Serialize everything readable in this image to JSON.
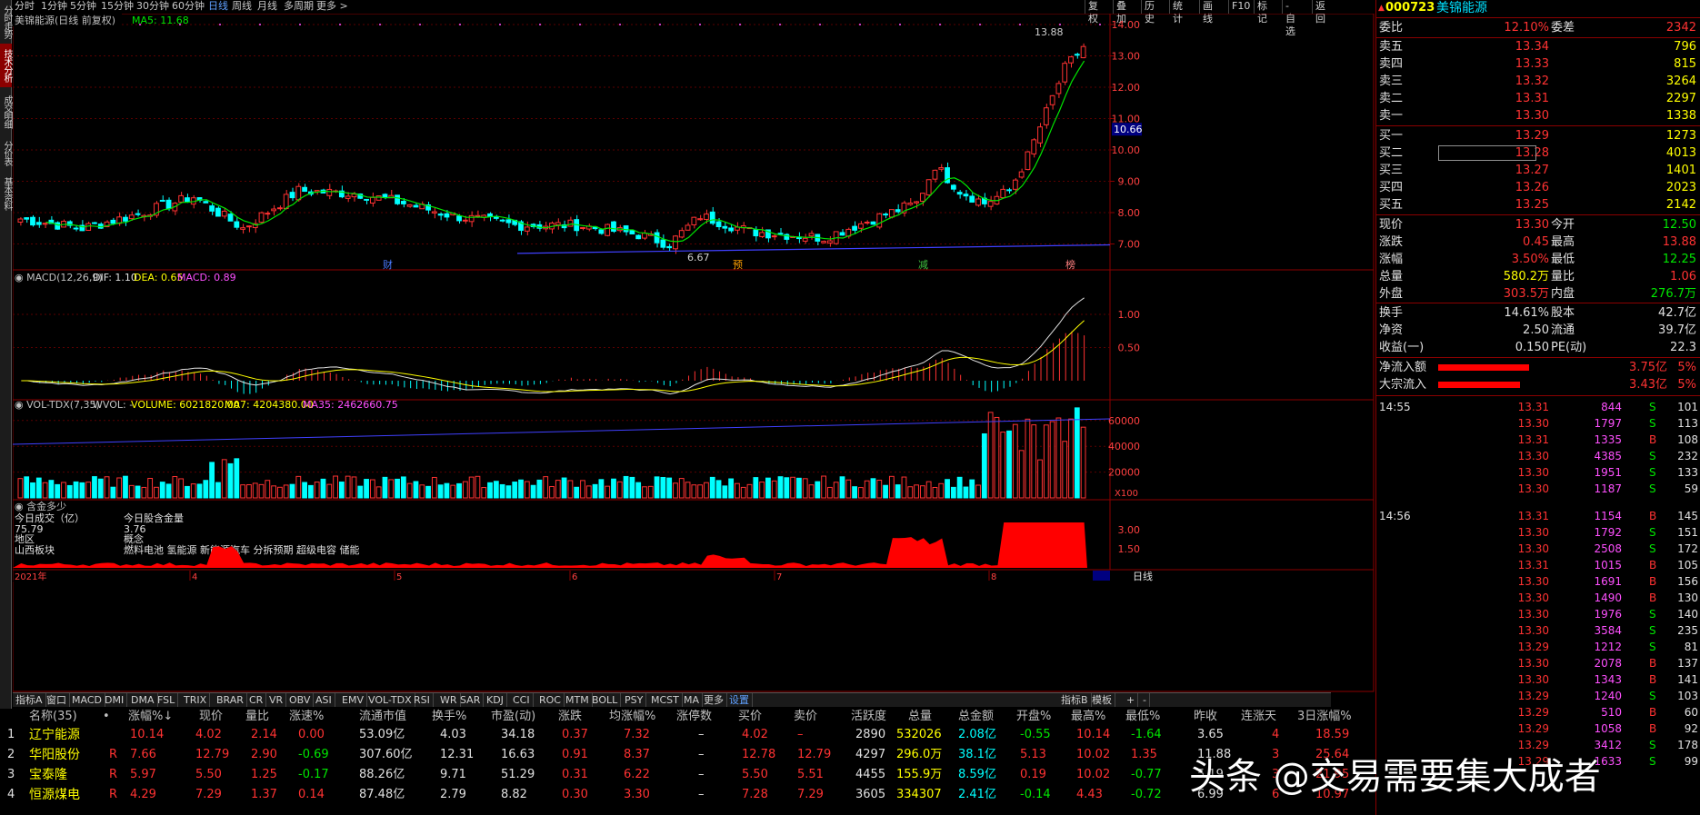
{
  "periods": [
    "分时",
    "1分钟",
    "5分钟",
    "15分钟",
    "30分钟",
    "60分钟",
    "日线",
    "周线",
    "月线",
    "多周期",
    "更多 >"
  ],
  "active_period": "日线",
  "left_tabs": [
    "分时走势",
    "技术分析",
    "成交明细",
    "分价表",
    "基本资料"
  ],
  "right_tools": [
    "复权",
    "叠加",
    "历史",
    "统计",
    "画线",
    "F10",
    "标记",
    "-自选",
    "返回"
  ],
  "chart": {
    "title": "美锦能源(日线 前复权)",
    "ma5_label": "MA5: 11.68",
    "price_axis": [
      "14.00",
      "13.00",
      "12.00",
      "11.00",
      "10.00",
      "9.00",
      "8.00",
      "7.00"
    ],
    "current_price_tag": "10.66",
    "high_label": "13.88",
    "low_label": "6.67",
    "event_marks": [
      "财",
      "预",
      "减",
      "榜"
    ],
    "macd_label": "MACD(12,26,9)",
    "macd_dif": "DIF: 1.10",
    "macd_dea": "DEA: 0.65",
    "macd_macd": "MACD: 0.89",
    "macd_axis": [
      "1.00",
      "0.50"
    ],
    "vol_label": "VOL-TDX(7,35)",
    "vol_wvol": "WVOL: -",
    "vol_volume": "VOLUME: 6021820.00",
    "vol_ma7": "MA7: 4204380.00",
    "vol_ma35": "MA35: 2462660.75",
    "vol_axis": [
      "60000",
      "40000",
      "20000"
    ],
    "vol_unit": "X100",
    "extra_title": "含金多少",
    "extra_rows": [
      {
        "a": "今日成交（亿）",
        "b": "今日股含金量"
      },
      {
        "a": "75.79",
        "b": "3.76"
      },
      {
        "a": "地区",
        "b": "概念"
      },
      {
        "a": "山西板块",
        "b": "燃料电池 氢能源 新能源汽车 分拆预期 超级电容 储能"
      }
    ],
    "extra_axis": [
      "3.00",
      "1.50"
    ],
    "time_axis": [
      "2021年",
      "4",
      "5",
      "6",
      "7",
      "8"
    ],
    "right_tab": "日线"
  },
  "indicator_tabs": [
    "指标A",
    "窗口",
    "MACD",
    "DMI",
    "DMA",
    "FSL",
    "TRIX",
    "BRAR",
    "CR",
    "VR",
    "OBV",
    "ASI",
    "EMV",
    "VOL-TDX",
    "RSI",
    "WR",
    "SAR",
    "KDJ",
    "CCI",
    "ROC",
    "MTM",
    "BOLL",
    "PSY",
    "MCST",
    "MA",
    "更多",
    "设置"
  ],
  "indicator_right": [
    "指标B",
    "模板",
    "+",
    "-"
  ],
  "quote": {
    "code": "000723",
    "name": "美锦能源",
    "weibi_label": "委比",
    "weibi": "12.10%",
    "weicha_label": "委差",
    "weicha": "2342",
    "asks": [
      {
        "label": "卖五",
        "price": "13.34",
        "vol": "796"
      },
      {
        "label": "卖四",
        "price": "13.33",
        "vol": "815"
      },
      {
        "label": "卖三",
        "price": "13.32",
        "vol": "3264"
      },
      {
        "label": "卖二",
        "price": "13.31",
        "vol": "2297"
      },
      {
        "label": "卖一",
        "price": "13.30",
        "vol": "1338"
      }
    ],
    "bids": [
      {
        "label": "买一",
        "price": "13.29",
        "vol": "1273"
      },
      {
        "label": "买二",
        "price": "13.28",
        "vol": "4013"
      },
      {
        "label": "买三",
        "price": "13.27",
        "vol": "1401"
      },
      {
        "label": "买四",
        "price": "13.26",
        "vol": "2023"
      },
      {
        "label": "买五",
        "price": "13.25",
        "vol": "2142"
      }
    ],
    "stats": [
      {
        "l1": "现价",
        "v1": "13.30",
        "c1": "red",
        "l2": "今开",
        "v2": "12.50",
        "c2": "green"
      },
      {
        "l1": "涨跌",
        "v1": "0.45",
        "c1": "red",
        "l2": "最高",
        "v2": "13.88",
        "c2": "red"
      },
      {
        "l1": "涨幅",
        "v1": "3.50%",
        "c1": "red",
        "l2": "最低",
        "v2": "12.25",
        "c2": "green"
      },
      {
        "l1": "总量",
        "v1": "580.2万",
        "c1": "yellow",
        "l2": "量比",
        "v2": "1.06",
        "c2": "red"
      },
      {
        "l1": "外盘",
        "v1": "303.5万",
        "c1": "red",
        "l2": "内盘",
        "v2": "276.7万",
        "c2": "green"
      }
    ],
    "stats2": [
      {
        "l1": "换手",
        "v1": "14.61%",
        "l2": "股本",
        "v2": "42.7亿"
      },
      {
        "l1": "净资",
        "v1": "2.50",
        "l2": "流通",
        "v2": "39.7亿"
      },
      {
        "l1": "收益(一)",
        "v1": "0.150",
        "l2": "PE(动)",
        "v2": "22.3"
      }
    ],
    "flows": [
      {
        "label": "净流入额",
        "value": "3.75亿",
        "pct": "5%"
      },
      {
        "label": "大宗流入",
        "value": "3.43亿",
        "pct": "5%"
      }
    ],
    "ticks": [
      {
        "time": "14:55",
        "price": "13.31",
        "vol": "844",
        "side": "S",
        "n": "101"
      },
      {
        "time": "",
        "price": "13.30",
        "vol": "1797",
        "side": "S",
        "n": "113"
      },
      {
        "time": "",
        "price": "13.31",
        "vol": "1335",
        "side": "B",
        "n": "108"
      },
      {
        "time": "",
        "price": "13.30",
        "vol": "4385",
        "side": "S",
        "n": "232"
      },
      {
        "time": "",
        "price": "13.30",
        "vol": "1951",
        "side": "S",
        "n": "133"
      },
      {
        "time": "",
        "price": "13.30",
        "vol": "1187",
        "side": "S",
        "n": "59"
      },
      {
        "time": "14:56",
        "price": "13.31",
        "vol": "1154",
        "side": "B",
        "n": "145"
      },
      {
        "time": "",
        "price": "13.30",
        "vol": "1792",
        "side": "S",
        "n": "151"
      },
      {
        "time": "",
        "price": "13.30",
        "vol": "2508",
        "side": "S",
        "n": "172"
      },
      {
        "time": "",
        "price": "13.31",
        "vol": "1015",
        "side": "B",
        "n": "105"
      },
      {
        "time": "",
        "price": "13.30",
        "vol": "1691",
        "side": "B",
        "n": "156"
      },
      {
        "time": "",
        "price": "13.30",
        "vol": "1490",
        "side": "B",
        "n": "130"
      },
      {
        "time": "",
        "price": "13.30",
        "vol": "1976",
        "side": "S",
        "n": "140"
      },
      {
        "time": "",
        "price": "13.30",
        "vol": "3584",
        "side": "S",
        "n": "235"
      },
      {
        "time": "",
        "price": "13.29",
        "vol": "1212",
        "side": "S",
        "n": "81"
      },
      {
        "time": "",
        "price": "13.30",
        "vol": "2078",
        "side": "B",
        "n": "137"
      },
      {
        "time": "",
        "price": "13.30",
        "vol": "1343",
        "side": "B",
        "n": "141"
      },
      {
        "time": "",
        "price": "13.29",
        "vol": "1240",
        "side": "S",
        "n": "103"
      },
      {
        "time": "",
        "price": "13.29",
        "vol": "510",
        "side": "B",
        "n": "60"
      },
      {
        "time": "",
        "price": "13.29",
        "vol": "1058",
        "side": "B",
        "n": "92"
      },
      {
        "time": "",
        "price": "13.29",
        "vol": "3412",
        "side": "S",
        "n": "178"
      },
      {
        "time": "",
        "price": "13.29",
        "vol": "1633",
        "side": "S",
        "n": "99"
      }
    ]
  },
  "table": {
    "headers": [
      "名称(35)",
      "•",
      "涨幅%↓",
      "现价",
      "量比",
      "涨速%",
      "流通市值",
      "换手%",
      "市盈(动)",
      "涨跌",
      "均涨幅%",
      "涨停数",
      "买价",
      "卖价",
      "活跃度",
      "总量",
      "总金额",
      "开盘%",
      "最高%",
      "最低%",
      "昨收",
      "连涨天",
      "3日涨幅%"
    ],
    "rows": [
      {
        "idx": "1",
        "name": "辽宁能源",
        "flag": "",
        "chg": "10.14",
        "price": "4.02",
        "lb": "2.14",
        "speed": "0.00",
        "mcap": "53.09亿",
        "turn": "4.03",
        "pe": "34.18",
        "diff": "0.37",
        "avg": "7.32",
        "limit": "–",
        "bid": "4.02",
        "ask": "–",
        "act": "2890",
        "vol": "532026",
        "amt": "2.08亿",
        "open": "-0.55",
        "hi": "10.14",
        "lo": "-1.64",
        "prev": "3.65",
        "days": "4",
        "d3": "18.59"
      },
      {
        "idx": "2",
        "name": "华阳股份",
        "flag": "R",
        "chg": "7.66",
        "price": "12.79",
        "lb": "2.90",
        "speed": "-0.69",
        "mcap": "307.60亿",
        "turn": "12.31",
        "pe": "16.63",
        "diff": "0.91",
        "avg": "8.37",
        "limit": "–",
        "bid": "12.78",
        "ask": "12.79",
        "act": "4297",
        "vol": "296.0万",
        "amt": "38.1亿",
        "open": "5.13",
        "hi": "10.02",
        "lo": "1.35",
        "prev": "11.88",
        "days": "3",
        "d3": "25.64"
      },
      {
        "idx": "3",
        "name": "宝泰隆",
        "flag": "R",
        "chg": "5.97",
        "price": "5.50",
        "lb": "1.25",
        "speed": "-0.17",
        "mcap": "88.26亿",
        "turn": "9.71",
        "pe": "51.29",
        "diff": "0.31",
        "avg": "6.22",
        "limit": "–",
        "bid": "5.50",
        "ask": "5.51",
        "act": "4455",
        "vol": "155.9万",
        "amt": "8.59亿",
        "open": "0.19",
        "hi": "10.02",
        "lo": "-0.77",
        "prev": "5.19",
        "days": "3",
        "d3": "21.95"
      },
      {
        "idx": "4",
        "name": "恒源煤电",
        "flag": "R",
        "chg": "4.29",
        "price": "7.29",
        "lb": "1.37",
        "speed": "0.14",
        "mcap": "87.48亿",
        "turn": "2.79",
        "pe": "8.82",
        "diff": "0.30",
        "avg": "3.30",
        "limit": "–",
        "bid": "7.28",
        "ask": "7.29",
        "act": "3605",
        "vol": "334307",
        "amt": "2.41亿",
        "open": "-0.14",
        "hi": "4.43",
        "lo": "-0.72",
        "prev": "6.99",
        "days": "6",
        "d3": "10.97"
      }
    ]
  },
  "watermark": "头条 @交易需要集大成者"
}
